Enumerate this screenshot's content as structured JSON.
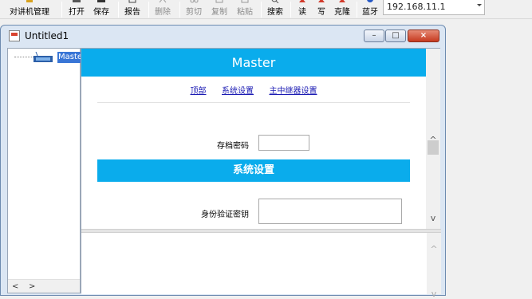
{
  "toolbar": {
    "buttons": [
      {
        "label": "对讲机管理",
        "icon": "intercom-icon"
      },
      {
        "label": "打开",
        "icon": "open-folder-icon"
      },
      {
        "label": "保存",
        "icon": "save-disk-icon"
      },
      {
        "label": "报告",
        "icon": "report-icon"
      },
      {
        "label": "删除",
        "icon": "delete-icon",
        "disabled": true
      },
      {
        "label": "剪切",
        "icon": "cut-icon",
        "disabled": true
      },
      {
        "label": "复制",
        "icon": "copy-icon",
        "disabled": true
      },
      {
        "label": "粘贴",
        "icon": "paste-icon",
        "disabled": true
      },
      {
        "label": "搜索",
        "icon": "search-icon"
      },
      {
        "label": "读",
        "icon": "read-icon"
      },
      {
        "label": "写",
        "icon": "write-icon"
      },
      {
        "label": "克隆",
        "icon": "clone-icon"
      },
      {
        "label": "蓝牙",
        "icon": "bluetooth-icon"
      }
    ],
    "ip_value": "192.168.11.1"
  },
  "window": {
    "title": "Untitled1",
    "min": "–",
    "max": "□",
    "close": "×"
  },
  "tree": {
    "node_label": "Master",
    "left_arrow": "<",
    "right_arrow": ">"
  },
  "page": {
    "header": "Master",
    "nav": [
      "顶部",
      "系统设置",
      "主中继器设置"
    ],
    "archive_password_label": "存档密码",
    "archive_password_value": "",
    "system_settings_header": "系统设置",
    "auth_key_label": "身份验证密钥",
    "auth_key_value": ""
  },
  "scroll": {
    "up": "^",
    "down": "v"
  },
  "colors": {
    "accent": "#0aacec",
    "link": "#1a1ab3",
    "selection": "#3875d6",
    "close_button": "#c6391f"
  }
}
